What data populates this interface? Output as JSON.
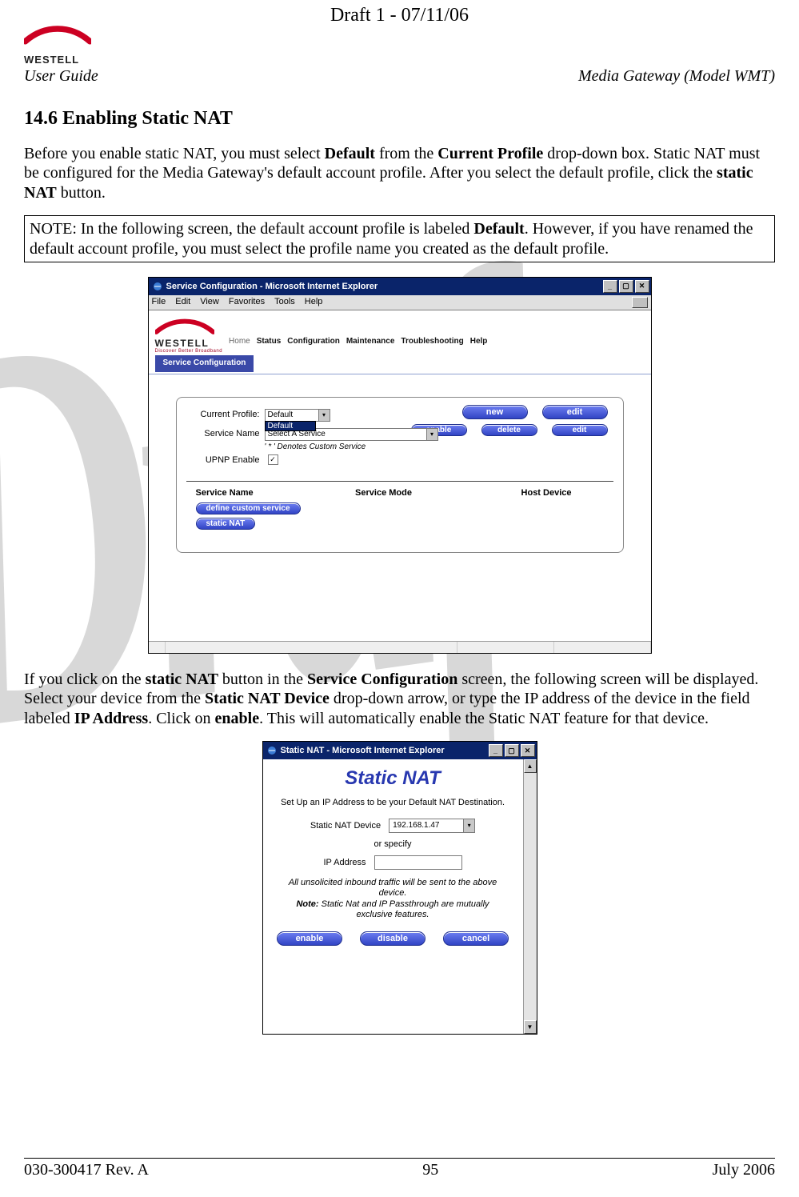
{
  "draft_header": "Draft 1 - 07/11/06",
  "watermark": "Draft",
  "header": {
    "brand": "WESTELL",
    "left": "User Guide",
    "right": "Media Gateway (Model WMT)"
  },
  "section_title": "14.6  Enabling Static NAT",
  "para1": {
    "pre": "Before you enable static NAT, you must select ",
    "b1": "Default",
    "mid1": " from the ",
    "b2": "Current Profile",
    "mid2": " drop-down box. Static NAT must be configured for the Media Gateway's default account profile. After you select the default profile, click the ",
    "b3": "static NAT",
    "post": " button."
  },
  "note": {
    "pre": "NOTE: In the following screen, the default account profile is labeled ",
    "b1": "Default",
    "post": ". However, if you have renamed the default account profile, you must select the profile name you created as the default profile."
  },
  "ss1": {
    "title": "Service Configuration - Microsoft Internet Explorer",
    "menus": [
      "File",
      "Edit",
      "View",
      "Favorites",
      "Tools",
      "Help"
    ],
    "brand": "WESTELL",
    "tagline": "Discover Better Broadband",
    "tabs": [
      "Home",
      "Status",
      "Configuration",
      "Maintenance",
      "Troubleshooting",
      "Help"
    ],
    "subtab": "Service Configuration",
    "labels": {
      "current_profile": "Current Profile:",
      "service_name": "Service Name",
      "upnp": "UPNP Enable"
    },
    "profile_selected": "Default",
    "profile_option": "Default",
    "service_selected": "Select A Service",
    "denotes": "' * ' Denotes Custom Service",
    "upnp_checked": "✓",
    "buttons": {
      "new": "new",
      "edit": "edit",
      "enable": "enable",
      "delete": "delete",
      "edit2": "edit",
      "define": "define custom service",
      "static": "static NAT"
    },
    "thead": [
      "Service Name",
      "Service Mode",
      "Host Device"
    ]
  },
  "para2": {
    "pre": "If you click on the ",
    "b1": "static NAT",
    "mid1": " button in the ",
    "b2": "Service Configuration",
    "mid2": " screen, the following screen will be displayed. Select your device from the ",
    "b3": "Static NAT Device",
    "mid3": " drop-down arrow, or type the IP address of the device in the field labeled ",
    "b4": "IP Address",
    "mid4": ". Click on ",
    "b5": "enable",
    "post": ". This will automatically enable the Static NAT feature for that device."
  },
  "ss2": {
    "title": "Static NAT - Microsoft Internet Explorer",
    "h1": "Static NAT",
    "sub": "Set Up an IP Address to be your Default NAT Destination.",
    "device_label": "Static NAT Device",
    "device_value": "192.168.1.47",
    "or": "or specify",
    "ip_label": "IP Address",
    "note_line1": "All unsolicited inbound traffic will be sent to the above device.",
    "note_line2_b": "Note:",
    "note_line2_rest": " Static Nat and IP Passthrough are mutually exclusive features.",
    "buttons": {
      "enable": "enable",
      "disable": "disable",
      "cancel": "cancel"
    }
  },
  "footer": {
    "left": "030-300417 Rev. A",
    "center": "95",
    "right": "July 2006"
  }
}
